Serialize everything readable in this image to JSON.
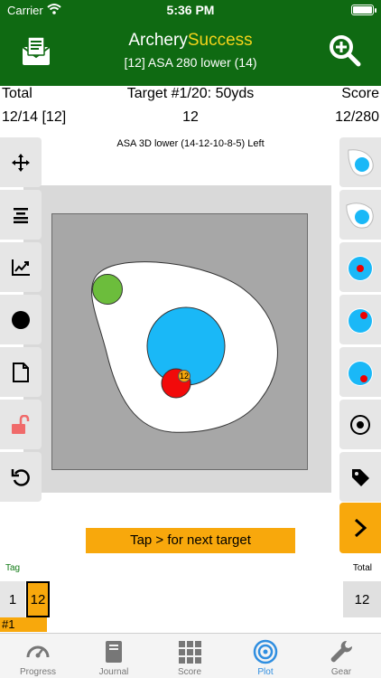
{
  "status_bar": {
    "carrier": "Carrier",
    "time": "5:36 PM"
  },
  "header": {
    "title_part1": "Archery",
    "title_part2": "Success",
    "subtitle": "[12] ASA 280 lower (14)",
    "left_icon": "envelope-document-icon",
    "right_icon": "zoom-plus-icon"
  },
  "summary": {
    "total_label": "Total",
    "target_label": "Target #1/20: 50yds",
    "score_label": "Score",
    "total_value": "12/14 [12]",
    "target_value": "12",
    "score_value": "12/280"
  },
  "target_name": "ASA 3D lower (14-12-10-8-5) Left",
  "left_tools": [
    "move-icon",
    "align-icon",
    "chart-icon",
    "dot-icon",
    "document-icon",
    "unlock-icon",
    "undo-icon"
  ],
  "right_tools": [
    "target-face-1",
    "target-face-2",
    "target-face-3",
    "target-face-4",
    "target-face-5",
    "crosshair-icon",
    "tag-icon",
    "next-chevron-icon"
  ],
  "arrow_label": "12",
  "next_banner": "Tap > for next target",
  "end": {
    "tag_label": "Tag",
    "total_label": "Total",
    "arrow_index": "1",
    "arrow_score": "12",
    "total": "12",
    "end_number": "#1"
  },
  "tabs": [
    {
      "label": "Progress",
      "icon": "gauge-icon"
    },
    {
      "label": "Journal",
      "icon": "book-icon"
    },
    {
      "label": "Score",
      "icon": "grid-icon"
    },
    {
      "label": "Plot",
      "icon": "target-icon",
      "active": true
    },
    {
      "label": "Gear",
      "icon": "wrench-icon"
    }
  ],
  "colors": {
    "header_green": "#0f6a12",
    "title_accent": "#f5d41a",
    "orange": "#f8a80c",
    "active_tab": "#2f8ee0",
    "scoring_blue": "#1ab8f7",
    "scoring_red": "#f20a0a",
    "scoring_green": "#6cbd3c"
  }
}
